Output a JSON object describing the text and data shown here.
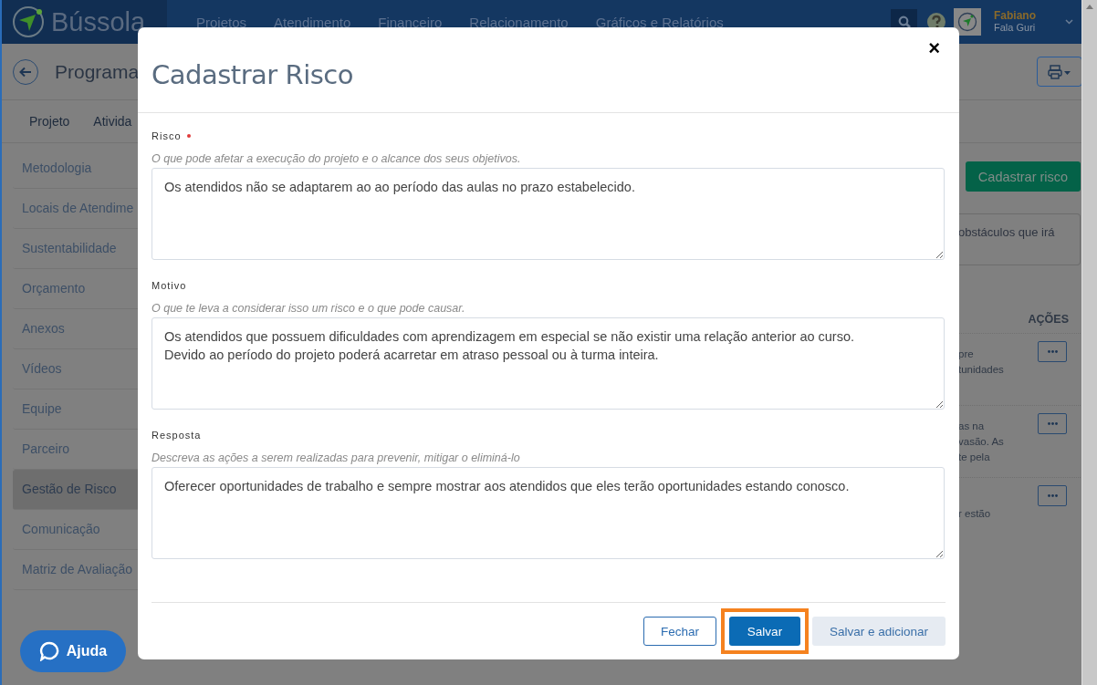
{
  "header": {
    "brand": "Bússola",
    "nav": [
      "Projetos",
      "Atendimento",
      "Financeiro",
      "Relacionamento",
      "Gráficos e Relatórios"
    ],
    "user": {
      "name": "Fabiano",
      "org": "Fala Guri"
    }
  },
  "page": {
    "title": "Programa",
    "tabs": [
      "Projeto",
      "Ativida"
    ]
  },
  "sidebar": {
    "items": [
      {
        "label": "Metodologia",
        "selected": false
      },
      {
        "label": "Locais de Atendime",
        "selected": false
      },
      {
        "label": "Sustentabilidade",
        "selected": false
      },
      {
        "label": "Orçamento",
        "selected": false
      },
      {
        "label": "Anexos",
        "selected": false
      },
      {
        "label": "Vídeos",
        "selected": false
      },
      {
        "label": "Equipe",
        "selected": false
      },
      {
        "label": "Parceiro",
        "selected": false
      },
      {
        "label": "Gestão de Risco",
        "selected": true
      },
      {
        "label": "Comunicação",
        "selected": false
      },
      {
        "label": "Matriz de Avaliação",
        "selected": false
      }
    ]
  },
  "risk_panel": {
    "add_button": "Cadastrar risco",
    "description": "obstáculos que irá",
    "actions_heading": "AÇÕES",
    "rows": [
      {
        "lines": [
          "pre",
          "tunidades"
        ]
      },
      {
        "lines": [
          "as na",
          "vasão. As",
          "te pela"
        ]
      },
      {
        "lines": [
          "r estão"
        ]
      }
    ]
  },
  "help_button": "Ajuda",
  "modal": {
    "title": "Cadastrar Risco",
    "close": "×",
    "fields": [
      {
        "label": "Risco",
        "required": true,
        "hint": "O que pode afetar a execução do projeto e o alcance dos seus objetivos.",
        "value": "Os atendidos não se adaptarem ao ao período das aulas no prazo estabelecido."
      },
      {
        "label": "Motivo",
        "required": false,
        "hint": "O que te leva a considerar isso um risco e o que pode causar.",
        "value": "Os atendidos que possuem dificuldades com aprendizagem em especial se não existir uma relação anterior ao curso.\nDevido ao período do projeto poderá acarretar em atraso pessoal ou à turma inteira."
      },
      {
        "label": "Resposta",
        "required": false,
        "hint": "Descreva as ações a serem realizadas para prevenir, mitigar o eliminá-lo",
        "value": "Oferecer oportunidades de trabalho e sempre mostrar aos atendidos que eles terão oportunidades estando conosco."
      }
    ],
    "buttons": [
      {
        "label": "Fechar",
        "kind": "outline",
        "highlighted": false
      },
      {
        "label": "Salvar",
        "kind": "primary",
        "highlighted": true
      },
      {
        "label": "Salvar e adicionar",
        "kind": "secondary",
        "highlighted": false
      }
    ]
  }
}
